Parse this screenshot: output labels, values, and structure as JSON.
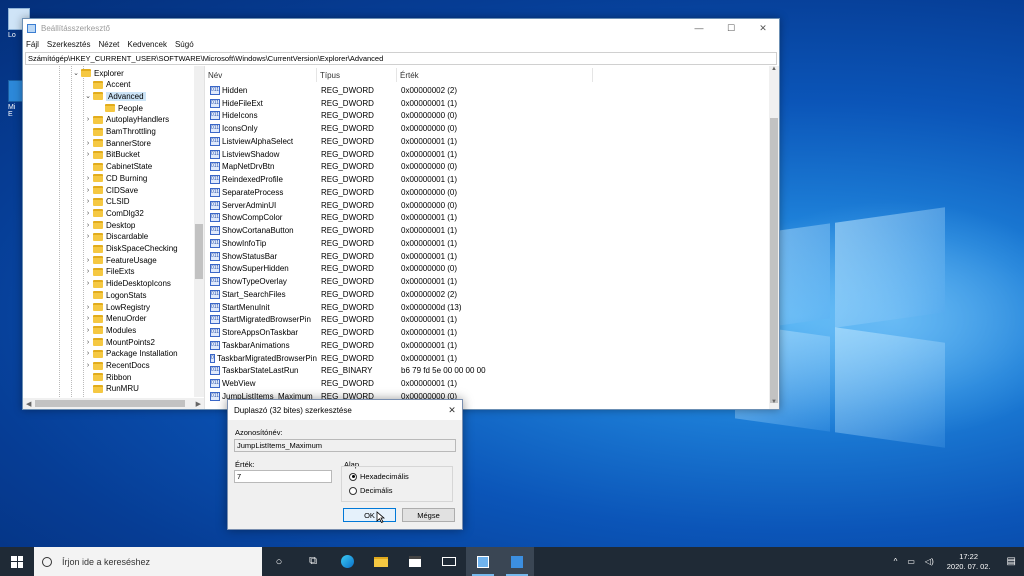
{
  "desktop": {
    "icons": [
      {
        "label": "Lo"
      },
      {
        "label": "Mi"
      },
      {
        "label": "E"
      }
    ]
  },
  "regedit": {
    "title": "Beállításszerkesztő",
    "menu": [
      "Fájl",
      "Szerkesztés",
      "Nézet",
      "Kedvencek",
      "Súgó"
    ],
    "address": "Számítógép\\HKEY_CURRENT_USER\\SOFTWARE\\Microsoft\\Windows\\CurrentVersion\\Explorer\\Advanced",
    "tree": [
      {
        "label": "Explorer",
        "caret": "v",
        "level": 0
      },
      {
        "label": "Accent",
        "caret": "",
        "level": 1
      },
      {
        "label": "Advanced",
        "caret": "v",
        "level": 1,
        "selected": true
      },
      {
        "label": "People",
        "caret": "",
        "level": 2
      },
      {
        "label": "AutoplayHandlers",
        "caret": ">",
        "level": 1
      },
      {
        "label": "BamThrottling",
        "caret": "",
        "level": 1
      },
      {
        "label": "BannerStore",
        "caret": ">",
        "level": 1
      },
      {
        "label": "BitBucket",
        "caret": ">",
        "level": 1
      },
      {
        "label": "CabinetState",
        "caret": "",
        "level": 1
      },
      {
        "label": "CD Burning",
        "caret": ">",
        "level": 1
      },
      {
        "label": "CIDSave",
        "caret": ">",
        "level": 1
      },
      {
        "label": "CLSID",
        "caret": ">",
        "level": 1
      },
      {
        "label": "ComDlg32",
        "caret": ">",
        "level": 1
      },
      {
        "label": "Desktop",
        "caret": ">",
        "level": 1
      },
      {
        "label": "Discardable",
        "caret": ">",
        "level": 1
      },
      {
        "label": "DiskSpaceChecking",
        "caret": "",
        "level": 1
      },
      {
        "label": "FeatureUsage",
        "caret": ">",
        "level": 1
      },
      {
        "label": "FileExts",
        "caret": ">",
        "level": 1
      },
      {
        "label": "HideDesktopIcons",
        "caret": ">",
        "level": 1
      },
      {
        "label": "LogonStats",
        "caret": "",
        "level": 1
      },
      {
        "label": "LowRegistry",
        "caret": ">",
        "level": 1
      },
      {
        "label": "MenuOrder",
        "caret": ">",
        "level": 1
      },
      {
        "label": "Modules",
        "caret": ">",
        "level": 1
      },
      {
        "label": "MountPoints2",
        "caret": ">",
        "level": 1
      },
      {
        "label": "Package Installation",
        "caret": ">",
        "level": 1
      },
      {
        "label": "RecentDocs",
        "caret": ">",
        "level": 1
      },
      {
        "label": "Ribbon",
        "caret": "",
        "level": 1
      },
      {
        "label": "RunMRU",
        "caret": "",
        "level": 1
      }
    ],
    "columns": [
      "Név",
      "Típus",
      "Érték"
    ],
    "values": [
      {
        "name": "Hidden",
        "type": "REG_DWORD",
        "data": "0x00000002 (2)"
      },
      {
        "name": "HideFileExt",
        "type": "REG_DWORD",
        "data": "0x00000001 (1)"
      },
      {
        "name": "HideIcons",
        "type": "REG_DWORD",
        "data": "0x00000000 (0)"
      },
      {
        "name": "IconsOnly",
        "type": "REG_DWORD",
        "data": "0x00000000 (0)"
      },
      {
        "name": "ListviewAlphaSelect",
        "type": "REG_DWORD",
        "data": "0x00000001 (1)"
      },
      {
        "name": "ListviewShadow",
        "type": "REG_DWORD",
        "data": "0x00000001 (1)"
      },
      {
        "name": "MapNetDrvBtn",
        "type": "REG_DWORD",
        "data": "0x00000000 (0)"
      },
      {
        "name": "ReindexedProfile",
        "type": "REG_DWORD",
        "data": "0x00000001 (1)"
      },
      {
        "name": "SeparateProcess",
        "type": "REG_DWORD",
        "data": "0x00000000 (0)"
      },
      {
        "name": "ServerAdminUI",
        "type": "REG_DWORD",
        "data": "0x00000000 (0)"
      },
      {
        "name": "ShowCompColor",
        "type": "REG_DWORD",
        "data": "0x00000001 (1)"
      },
      {
        "name": "ShowCortanaButton",
        "type": "REG_DWORD",
        "data": "0x00000001 (1)"
      },
      {
        "name": "ShowInfoTip",
        "type": "REG_DWORD",
        "data": "0x00000001 (1)"
      },
      {
        "name": "ShowStatusBar",
        "type": "REG_DWORD",
        "data": "0x00000001 (1)"
      },
      {
        "name": "ShowSuperHidden",
        "type": "REG_DWORD",
        "data": "0x00000000 (0)"
      },
      {
        "name": "ShowTypeOverlay",
        "type": "REG_DWORD",
        "data": "0x00000001 (1)"
      },
      {
        "name": "Start_SearchFiles",
        "type": "REG_DWORD",
        "data": "0x00000002 (2)"
      },
      {
        "name": "StartMenuInit",
        "type": "REG_DWORD",
        "data": "0x0000000d (13)"
      },
      {
        "name": "StartMigratedBrowserPin",
        "type": "REG_DWORD",
        "data": "0x00000001 (1)"
      },
      {
        "name": "StoreAppsOnTaskbar",
        "type": "REG_DWORD",
        "data": "0x00000001 (1)"
      },
      {
        "name": "TaskbarAnimations",
        "type": "REG_DWORD",
        "data": "0x00000001 (1)"
      },
      {
        "name": "TaskbarMigratedBrowserPin",
        "type": "REG_DWORD",
        "data": "0x00000001 (1)"
      },
      {
        "name": "TaskbarStateLastRun",
        "type": "REG_BINARY",
        "data": "b6 79 fd 5e 00 00 00 00"
      },
      {
        "name": "WebView",
        "type": "REG_DWORD",
        "data": "0x00000001 (1)"
      },
      {
        "name": "JumpListItems_Maximum",
        "type": "REG_DWORD",
        "data": "0x00000000 (0)"
      }
    ]
  },
  "dialog": {
    "title": "Duplaszó (32 bites) szerkesztése",
    "name_label": "Azonosítónév:",
    "name_value": "JumpListItems_Maximum",
    "value_label": "Érték:",
    "value_value": "7",
    "base_label": "Alap",
    "radio_hex": "Hexadecimális",
    "radio_dec": "Decimális",
    "ok": "OK",
    "cancel": "Mégse"
  },
  "taskbar": {
    "search_placeholder": "Írjon ide a kereséshez",
    "time": "17:22",
    "date": "2020. 07. 02."
  },
  "colors": {
    "accent": "#0078d7",
    "taskbar": "#1f2a36",
    "selection": "#cce4f7"
  }
}
